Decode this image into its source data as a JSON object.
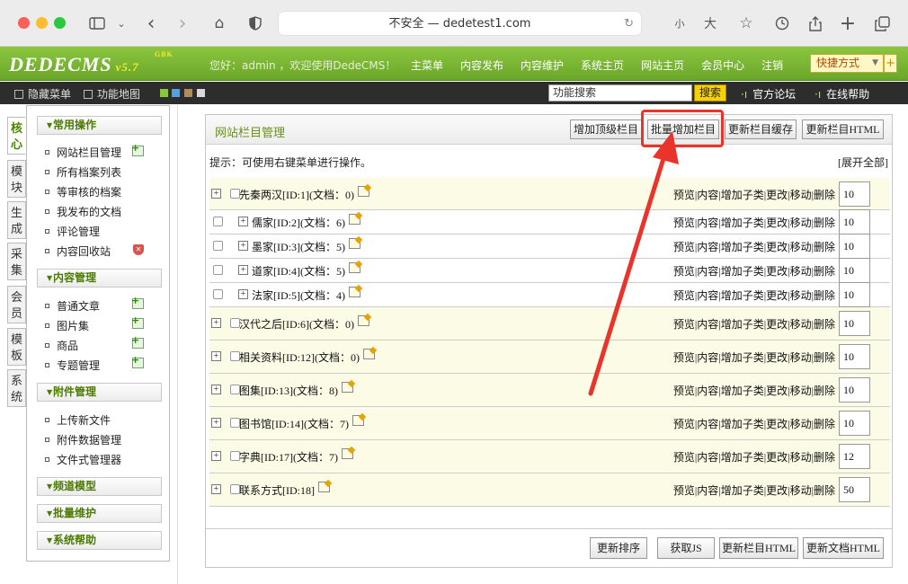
{
  "browser": {
    "url_text": "不安全 — dedetest1.com",
    "font_small": "小",
    "font_large": "大"
  },
  "header": {
    "logo": "DEDECMS",
    "version": "v5.7",
    "edition": "GBK",
    "welcome": "您好：admin ，欢迎使用DedeCMS！",
    "nav": [
      "主菜单",
      "内容发布",
      "内容维护",
      "系统主页",
      "网站主页",
      "会员中心",
      "注销"
    ],
    "quick": "快捷方式",
    "quick_add": "+"
  },
  "subbar": {
    "hide_menu": "隐藏菜单",
    "func_map": "功能地图",
    "search_value": "功能搜索",
    "search_btn": "搜索",
    "forum": "官方论坛",
    "help": "在线帮助",
    "swatch_colors": [
      "#8cc63f",
      "#4fa3e0",
      "#b38b59",
      "#d9d9d9"
    ]
  },
  "vtabs": [
    "核心",
    "模块",
    "生成",
    "采集",
    "会员",
    "模板",
    "系统"
  ],
  "sidebar": {
    "sections": [
      {
        "title": "常用操作",
        "items": [
          "网站栏目管理",
          "所有档案列表",
          "等审核的档案",
          "我发布的文档",
          "评论管理",
          "内容回收站"
        ]
      },
      {
        "title": "内容管理",
        "items": [
          "普通文章",
          "图片集",
          "商品",
          "专题管理"
        ]
      },
      {
        "title": "附件管理",
        "items": [
          "上传新文件",
          "附件数据管理",
          "文件式管理器"
        ]
      },
      {
        "title": "频道模型",
        "items": []
      },
      {
        "title": "批量维护",
        "items": []
      },
      {
        "title": "系统帮助",
        "items": []
      }
    ]
  },
  "main": {
    "title": "网站栏目管理",
    "buttons": [
      "增加顶级栏目",
      "批量增加栏目",
      "更新栏目缓存",
      "更新栏目HTML"
    ],
    "hint": "提示：可使用右键菜单进行操作。",
    "expand_all": "[展开全部]",
    "ops": [
      "预览",
      "内容",
      "增加子类",
      "更改",
      "移动",
      "删除"
    ],
    "rows": [
      {
        "name": "先秦两汉[ID:1](文档：0)",
        "order": "10",
        "level": 0
      },
      {
        "name": "儒家[ID:2](文档：6)",
        "order": "10",
        "level": 1
      },
      {
        "name": "墨家[ID:3](文档：5)",
        "order": "10",
        "level": 1
      },
      {
        "name": "道家[ID:4](文档：5)",
        "order": "10",
        "level": 1
      },
      {
        "name": "法家[ID:5](文档：4)",
        "order": "10",
        "level": 1
      },
      {
        "name": "汉代之后[ID:6](文档：0)",
        "order": "10",
        "level": 0
      },
      {
        "name": "相关资料[ID:12](文档：0)",
        "order": "10",
        "level": 0
      },
      {
        "name": "图集[ID:13](文档：8)",
        "order": "10",
        "level": 0
      },
      {
        "name": "图书馆[ID:14](文档：7)",
        "order": "10",
        "level": 0
      },
      {
        "name": "字典[ID:17](文档：7)",
        "order": "12",
        "level": 0
      },
      {
        "name": "联系方式[ID:18]",
        "order": "50",
        "level": 0
      }
    ],
    "bottom_buttons": [
      "更新排序",
      "获取JS",
      "更新栏目HTML",
      "更新文档HTML"
    ]
  },
  "annotation": {
    "color": "#e8342a"
  }
}
